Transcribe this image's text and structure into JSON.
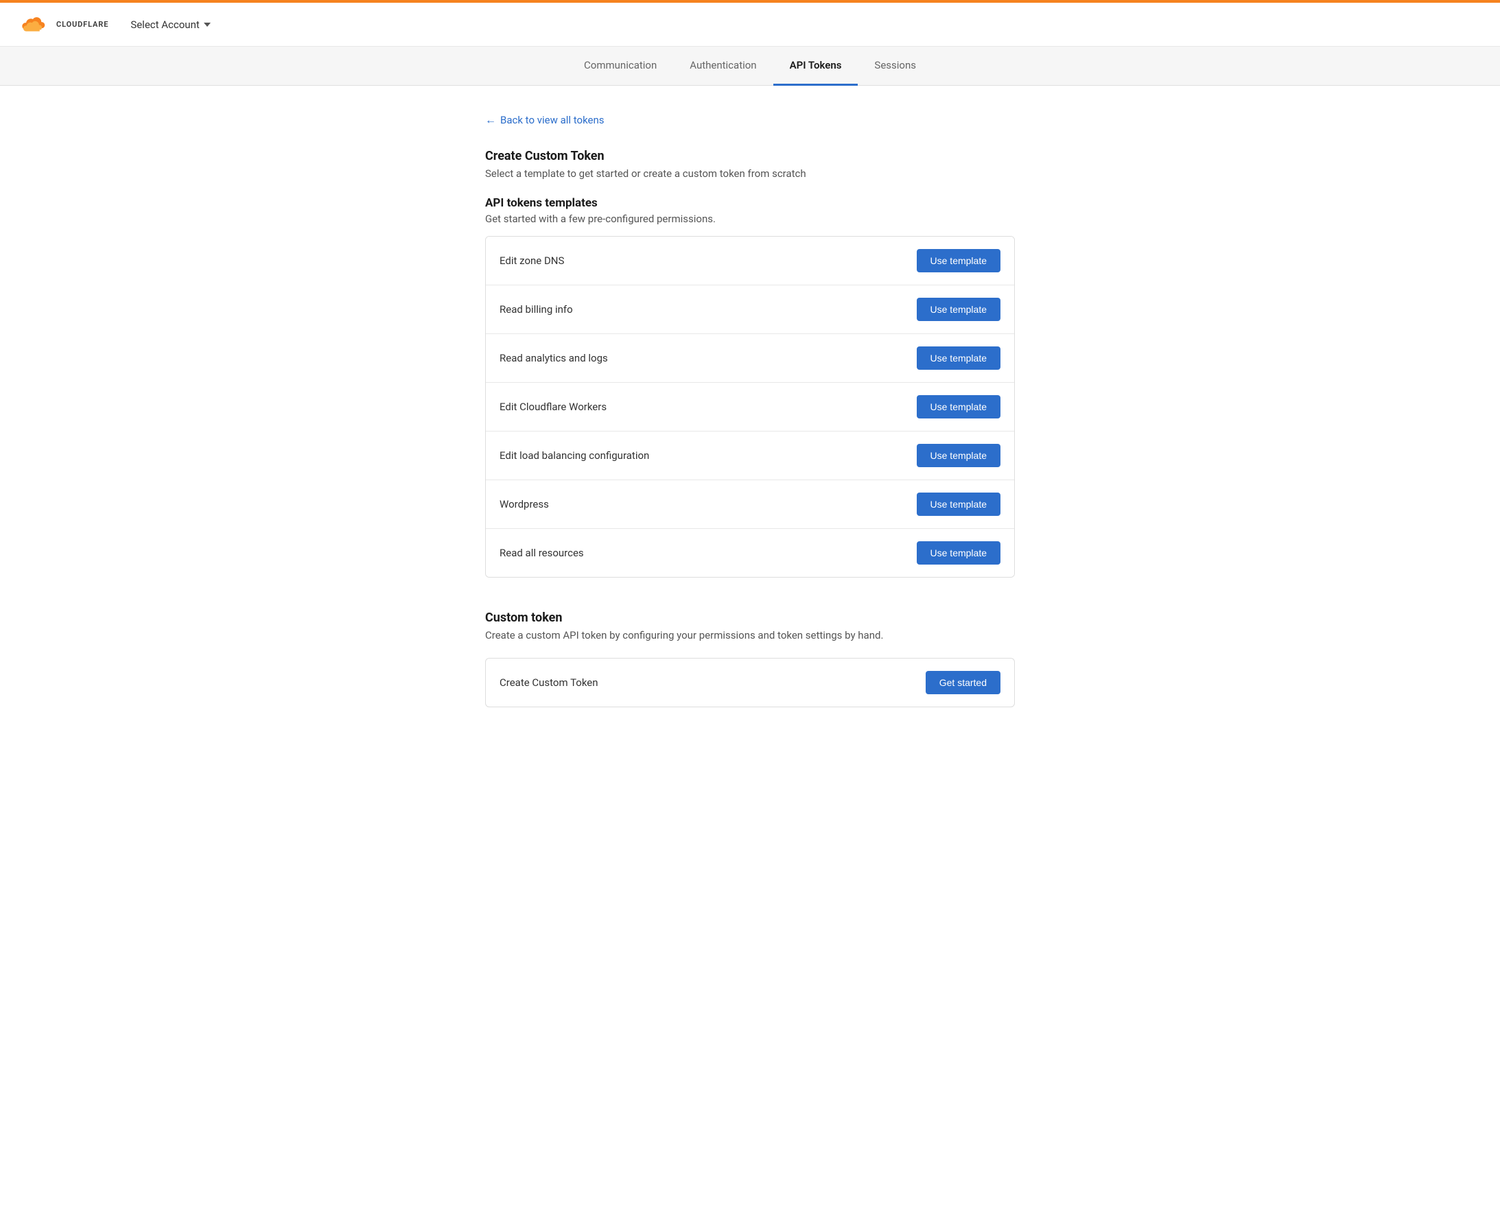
{
  "topbar": {
    "color": "#f6821f"
  },
  "header": {
    "logo_text": "CLOUDFLARE",
    "select_account_label": "Select Account"
  },
  "nav": {
    "tabs": [
      {
        "label": "Communication",
        "active": false
      },
      {
        "label": "Authentication",
        "active": false
      },
      {
        "label": "API Tokens",
        "active": true
      },
      {
        "label": "Sessions",
        "active": false
      }
    ]
  },
  "back_link": {
    "label": "Back to view all tokens"
  },
  "create_section": {
    "title": "Create Custom Token",
    "description": "Select a template to get started or create a custom token from scratch"
  },
  "templates_section": {
    "heading": "API tokens templates",
    "description": "Get started with a few pre-configured permissions.",
    "templates": [
      {
        "name": "Edit zone DNS",
        "button_label": "Use template"
      },
      {
        "name": "Read billing info",
        "button_label": "Use template"
      },
      {
        "name": "Read analytics and logs",
        "button_label": "Use template"
      },
      {
        "name": "Edit Cloudflare Workers",
        "button_label": "Use template"
      },
      {
        "name": "Edit load balancing configuration",
        "button_label": "Use template"
      },
      {
        "name": "Wordpress",
        "button_label": "Use template"
      },
      {
        "name": "Read all resources",
        "button_label": "Use template"
      }
    ]
  },
  "custom_section": {
    "heading": "Custom token",
    "description": "Create a custom API token by configuring your permissions and token settings by hand.",
    "row_label": "Create Custom Token",
    "button_label": "Get started"
  }
}
